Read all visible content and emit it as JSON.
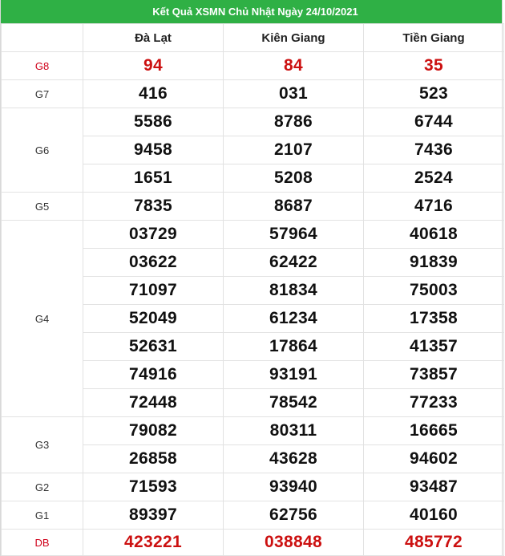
{
  "title": "Kết Quả XSMN Chủ Nhật Ngày 24/10/2021",
  "header_blank": "",
  "provinces": [
    "Đà Lạt",
    "Kiên Giang",
    "Tiền Giang"
  ],
  "prizes": [
    {
      "label": "G8",
      "special": true,
      "rows": [
        [
          "94",
          "84",
          "35"
        ]
      ]
    },
    {
      "label": "G7",
      "special": false,
      "rows": [
        [
          "416",
          "031",
          "523"
        ]
      ]
    },
    {
      "label": "G6",
      "special": false,
      "rows": [
        [
          "5586",
          "8786",
          "6744"
        ],
        [
          "9458",
          "2107",
          "7436"
        ],
        [
          "1651",
          "5208",
          "2524"
        ]
      ]
    },
    {
      "label": "G5",
      "special": false,
      "rows": [
        [
          "7835",
          "8687",
          "4716"
        ]
      ]
    },
    {
      "label": "G4",
      "special": false,
      "rows": [
        [
          "03729",
          "57964",
          "40618"
        ],
        [
          "03622",
          "62422",
          "91839"
        ],
        [
          "71097",
          "81834",
          "75003"
        ],
        [
          "52049",
          "61234",
          "17358"
        ],
        [
          "52631",
          "17864",
          "41357"
        ],
        [
          "74916",
          "93191",
          "73857"
        ],
        [
          "72448",
          "78542",
          "77233"
        ]
      ]
    },
    {
      "label": "G3",
      "special": false,
      "rows": [
        [
          "79082",
          "80311",
          "16665"
        ],
        [
          "26858",
          "43628",
          "94602"
        ]
      ]
    },
    {
      "label": "G2",
      "special": false,
      "rows": [
        [
          "71593",
          "93940",
          "93487"
        ]
      ]
    },
    {
      "label": "G1",
      "special": false,
      "rows": [
        [
          "89397",
          "62756",
          "40160"
        ]
      ]
    },
    {
      "label": "DB",
      "special": true,
      "rows": [
        [
          "423221",
          "038848",
          "485772"
        ]
      ]
    }
  ],
  "colors": {
    "header_green": "#2fb045",
    "special_red": "#cc1010",
    "label_red": "#d0021b"
  }
}
